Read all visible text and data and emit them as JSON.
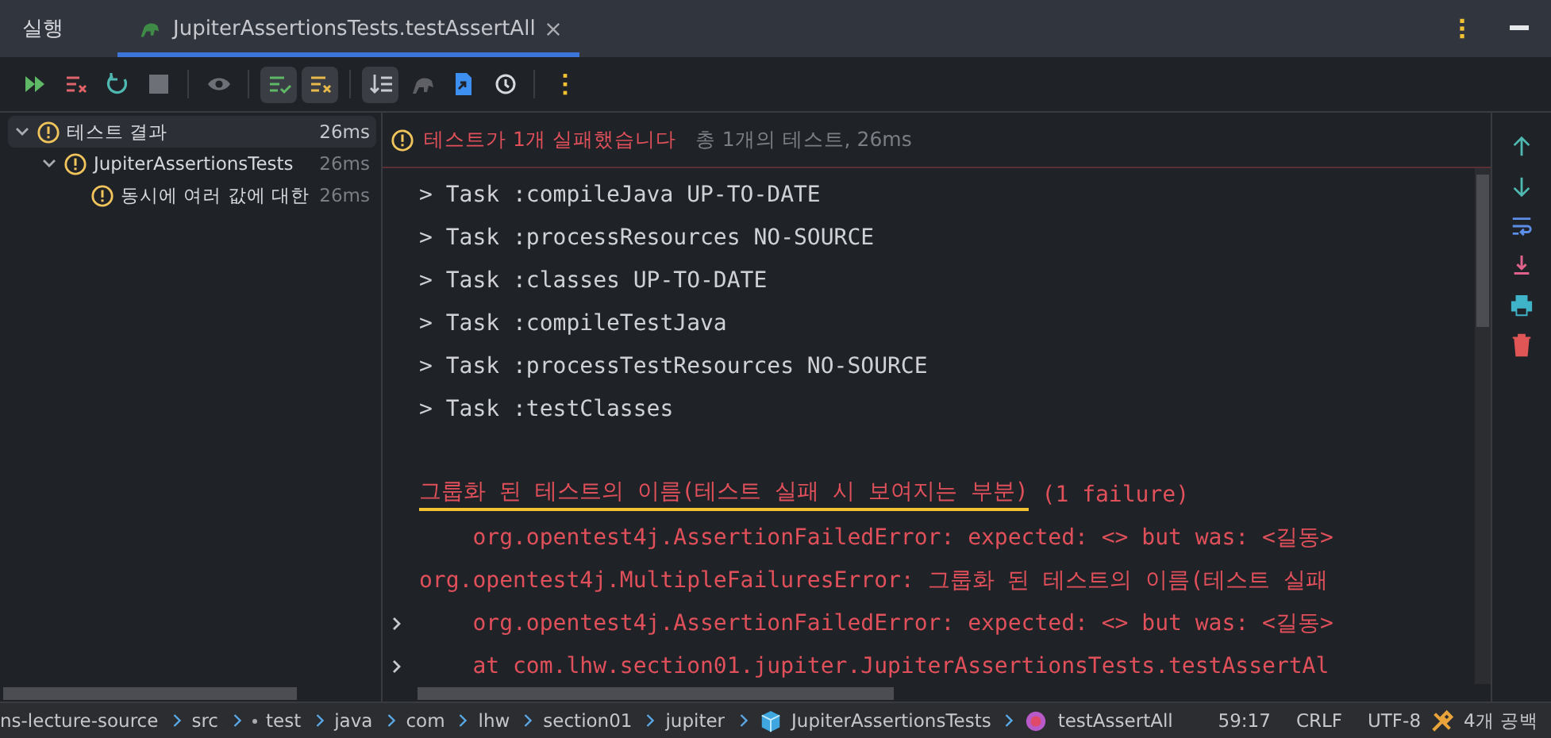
{
  "header": {
    "title": "실행",
    "tab": {
      "label": "JupiterAssertionsTests.testAssertAll",
      "selected": true
    }
  },
  "toolbar": [
    {
      "kind": "run",
      "selected": false
    },
    {
      "kind": "rerun-failed",
      "selected": false
    },
    {
      "kind": "rerun",
      "selected": false
    },
    {
      "kind": "stop",
      "selected": false
    },
    {
      "kind": "sep"
    },
    {
      "kind": "eye",
      "selected": false
    },
    {
      "kind": "sep"
    },
    {
      "kind": "passed",
      "selected": true
    },
    {
      "kind": "ignored",
      "selected": true
    },
    {
      "kind": "sep"
    },
    {
      "kind": "sort",
      "selected": true
    },
    {
      "kind": "elephant",
      "selected": false
    },
    {
      "kind": "export",
      "selected": false
    },
    {
      "kind": "history",
      "selected": false
    },
    {
      "kind": "sep"
    },
    {
      "kind": "more",
      "selected": false
    }
  ],
  "tree": [
    {
      "label": "테스트 결과",
      "time": "26ms",
      "selected": true,
      "expanded": true,
      "children": [
        {
          "label": "JupiterAssertionsTests",
          "time": "26ms",
          "selected": false,
          "expanded": true,
          "children": [
            {
              "label": "동시에 여러 값에 대한",
              "time": "26ms",
              "selected": false
            }
          ]
        }
      ]
    }
  ],
  "summary": {
    "status": "테스트가 1개 실패했습니다",
    "detail": "총 1개의 테스트, 26ms"
  },
  "console": [
    {
      "kind": "plain",
      "text": "> Task :compileJava UP-TO-DATE",
      "expandable": false
    },
    {
      "kind": "plain",
      "text": "> Task :processResources NO-SOURCE",
      "expandable": false
    },
    {
      "kind": "plain",
      "text": "> Task :classes UP-TO-DATE",
      "expandable": false
    },
    {
      "kind": "plain",
      "text": "> Task :compileTestJava",
      "expandable": false
    },
    {
      "kind": "plain",
      "text": "> Task :processTestResources NO-SOURCE",
      "expandable": false
    },
    {
      "kind": "plain",
      "text": "> Task :testClasses",
      "expandable": false
    },
    {
      "kind": "blank",
      "expandable": false
    },
    {
      "kind": "header",
      "text": "그룹화 된 테스트의 이름(테스트 실패 시 보여지는 부분)",
      "suffix": " (1 failure)",
      "expandable": false
    },
    {
      "kind": "error",
      "text": "    org.opentest4j.AssertionFailedError: expected: <> but was: <길동>",
      "expandable": false
    },
    {
      "kind": "error",
      "text": "org.opentest4j.MultipleFailuresError: 그룹화 된 테스트의 이름(테스트 실패",
      "expandable": false
    },
    {
      "kind": "error",
      "text": "    org.opentest4j.AssertionFailedError: expected: <> but was: <길동>",
      "expandable": true
    },
    {
      "kind": "error",
      "text": "    at com.lhw.section01.jupiter.JupiterAssertionsTests.testAssertAl",
      "expandable": true
    }
  ],
  "side_actions": [
    {
      "kind": "up"
    },
    {
      "kind": "down"
    },
    {
      "kind": "wrap"
    },
    {
      "kind": "scroll-end"
    },
    {
      "kind": "print"
    },
    {
      "kind": "trash"
    }
  ],
  "breadcrumbs": [
    {
      "label": "ns-lecture-source",
      "kind": "folder"
    },
    {
      "label": "src",
      "kind": "folder"
    },
    {
      "label": "test",
      "kind": "source-root"
    },
    {
      "label": "java",
      "kind": "folder"
    },
    {
      "label": "com",
      "kind": "folder"
    },
    {
      "label": "lhw",
      "kind": "folder"
    },
    {
      "label": "section01",
      "kind": "folder"
    },
    {
      "label": "jupiter",
      "kind": "folder"
    },
    {
      "label": "JupiterAssertionsTests",
      "kind": "class"
    },
    {
      "label": "testAssertAll",
      "kind": "method"
    }
  ],
  "status": {
    "position": "59:17",
    "line_ending": "CRLF",
    "encoding": "UTF-8",
    "indent": "4개 공백"
  }
}
